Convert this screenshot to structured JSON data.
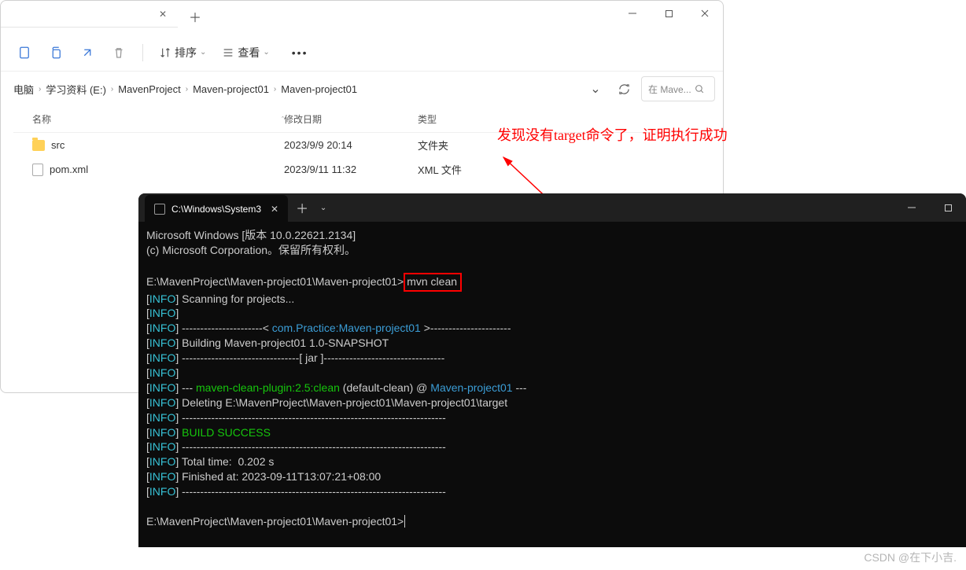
{
  "explorer": {
    "toolbar": {
      "sort_label": "排序",
      "view_label": "查看"
    },
    "breadcrumb": [
      "电脑",
      "学习资料 (E:)",
      "MavenProject",
      "Maven-project01",
      "Maven-project01"
    ],
    "search_placeholder": "在 Mave...",
    "columns": {
      "name": "名称",
      "date": "修改日期",
      "type": "类型"
    },
    "rows": [
      {
        "icon": "folder",
        "name": "src",
        "date": "2023/9/9 20:14",
        "type": "文件夹"
      },
      {
        "icon": "file",
        "name": "pom.xml",
        "date": "2023/9/11 11:32",
        "type": "XML 文件"
      }
    ]
  },
  "annotation": "发现没有target命令了，证明执行成功",
  "terminal": {
    "tab_title": "C:\\Windows\\System3",
    "lines": {
      "l1": "Microsoft Windows [版本 10.0.22621.2134]",
      "l2": "(c) Microsoft Corporation。保留所有权利。",
      "prompt1": "E:\\MavenProject\\Maven-project01\\Maven-project01>",
      "cmd": "mvn clean",
      "scan": "Scanning for projects...",
      "dashes_a": "----------------------< ",
      "project_id": "com.Practice:Maven-project01",
      "dashes_b": " >----------------------",
      "building": "Building Maven-project01 1.0-SNAPSHOT",
      "jar_a": "--------------------------------[ ",
      "jar_mid": "jar",
      "jar_b": " ]---------------------------------",
      "plugin_dash_a": "--- ",
      "plugin": "maven-clean-plugin:2.5:clean",
      "plugin_b": " (default-clean) @ ",
      "plugin_proj": "Maven-project01",
      "plugin_dash_b": " ---",
      "deleting": "Deleting E:\\MavenProject\\Maven-project01\\Maven-project01\\target",
      "long_dash": "------------------------------------------------------------------------",
      "build_success": "BUILD SUCCESS",
      "total_time": "Total time:  0.202 s",
      "finished": "Finished at: 2023-09-11T13:07:21+08:00",
      "prompt2": "E:\\MavenProject\\Maven-project01\\Maven-project01>"
    },
    "info_tag": "INFO"
  },
  "watermark": "CSDN @在下小吉."
}
